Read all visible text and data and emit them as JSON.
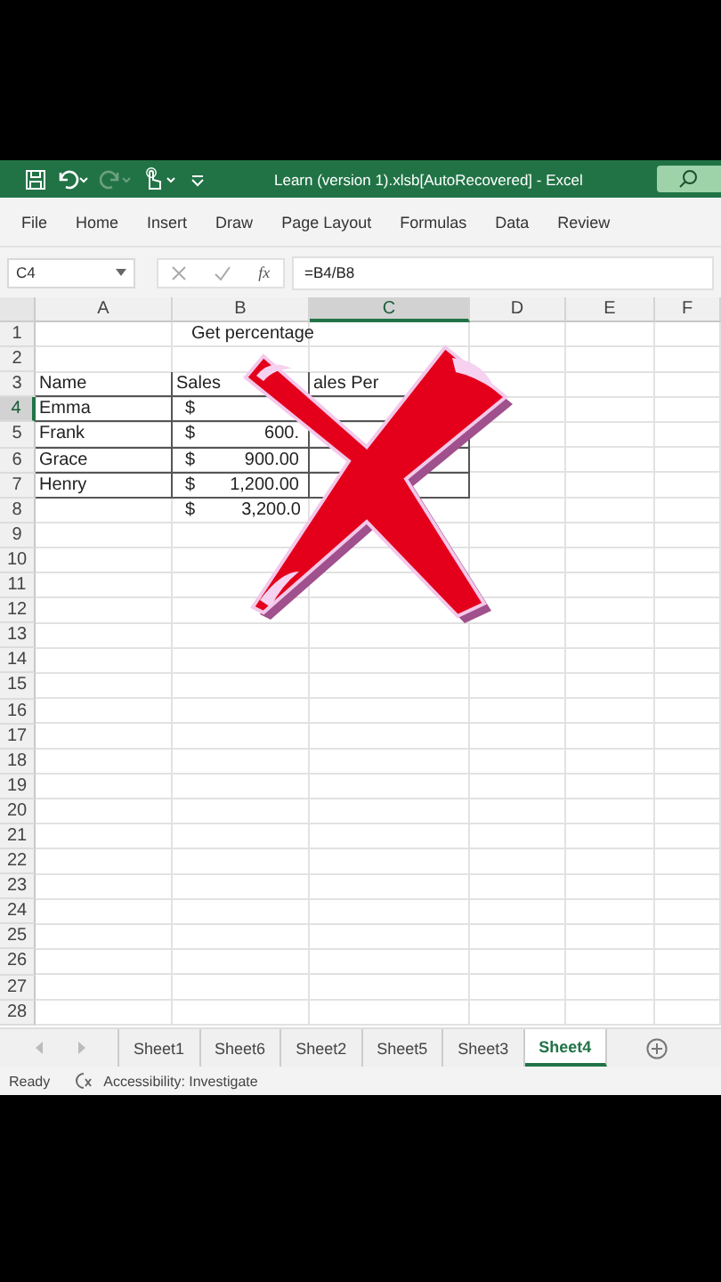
{
  "window": {
    "title": "Learn (version 1).xlsb[AutoRecovered]  -  Excel"
  },
  "quick_access": [
    {
      "kind": "save",
      "disabled": false
    },
    {
      "kind": "undo",
      "disabled": false
    },
    {
      "kind": "redo",
      "disabled": true
    },
    {
      "kind": "touch",
      "disabled": false
    },
    {
      "kind": "customize",
      "disabled": false
    }
  ],
  "ribbon_tabs": [
    "File",
    "Home",
    "Insert",
    "Draw",
    "Page Layout",
    "Formulas",
    "Data",
    "Review"
  ],
  "formula_bar": {
    "name_box": "C4",
    "function_label": "fx",
    "formula": "=B4/B8"
  },
  "columns": [
    {
      "label": "A",
      "selected": false
    },
    {
      "label": "B",
      "selected": false
    },
    {
      "label": "C",
      "selected": true
    },
    {
      "label": "D",
      "selected": false
    },
    {
      "label": "E",
      "selected": false
    },
    {
      "label": "F",
      "selected": false
    }
  ],
  "rows": [
    {
      "header": "1",
      "selected": false,
      "cells": [
        {
          "kind": "title",
          "text": "Get percentage",
          "boxed": false
        }
      ]
    },
    {
      "header": "2",
      "selected": false,
      "cells": []
    },
    {
      "header": "3",
      "selected": false,
      "cells": [
        {
          "kind": "text",
          "text": "Name",
          "boxed": true
        },
        {
          "kind": "text",
          "text": "Sales",
          "boxed": true
        },
        {
          "kind": "text",
          "text": "ales Per",
          "boxed": true
        }
      ]
    },
    {
      "header": "4",
      "selected": true,
      "cells": [
        {
          "kind": "text",
          "text": "Emma",
          "boxed": true
        },
        {
          "kind": "currency",
          "symbol": "$",
          "boxed": true
        },
        {
          "kind": "empty",
          "boxed": true
        }
      ]
    },
    {
      "header": "5",
      "selected": false,
      "cells": [
        {
          "kind": "text",
          "text": "Frank",
          "boxed": true
        },
        {
          "kind": "currency",
          "symbol": "$",
          "value": "600.",
          "boxed": true
        },
        {
          "kind": "empty",
          "boxed": true
        }
      ]
    },
    {
      "header": "6",
      "selected": false,
      "cells": [
        {
          "kind": "text",
          "text": "Grace",
          "boxed": true
        },
        {
          "kind": "currency",
          "symbol": "$",
          "value": "900.00",
          "boxed": true
        },
        {
          "kind": "empty",
          "boxed": true
        }
      ]
    },
    {
      "header": "7",
      "selected": false,
      "cells": [
        {
          "kind": "text",
          "text": "Henry",
          "boxed": true
        },
        {
          "kind": "currency",
          "symbol": "$",
          "value": "1,200.00",
          "boxed": true
        },
        {
          "kind": "empty",
          "boxed": true
        }
      ]
    },
    {
      "header": "8",
      "selected": false,
      "cells": [
        {
          "kind": "empty",
          "boxed": false
        },
        {
          "kind": "currency",
          "symbol": "$",
          "value": "3,200.0",
          "boxed": false
        }
      ]
    },
    {
      "header": "9",
      "selected": false,
      "cells": []
    },
    {
      "header": "10",
      "selected": false,
      "cells": []
    },
    {
      "header": "11",
      "selected": false,
      "cells": []
    },
    {
      "header": "12",
      "selected": false,
      "cells": []
    },
    {
      "header": "13",
      "selected": false,
      "cells": []
    },
    {
      "header": "14",
      "selected": false,
      "cells": []
    },
    {
      "header": "15",
      "selected": false,
      "cells": []
    },
    {
      "header": "16",
      "selected": false,
      "cells": []
    },
    {
      "header": "17",
      "selected": false,
      "cells": []
    },
    {
      "header": "18",
      "selected": false,
      "cells": []
    },
    {
      "header": "19",
      "selected": false,
      "cells": []
    },
    {
      "header": "20",
      "selected": false,
      "cells": []
    },
    {
      "header": "21",
      "selected": false,
      "cells": []
    },
    {
      "header": "22",
      "selected": false,
      "cells": []
    },
    {
      "header": "23",
      "selected": false,
      "cells": []
    },
    {
      "header": "24",
      "selected": false,
      "cells": []
    },
    {
      "header": "25",
      "selected": false,
      "cells": []
    },
    {
      "header": "26",
      "selected": false,
      "cells": []
    },
    {
      "header": "27",
      "selected": false,
      "cells": []
    },
    {
      "header": "28",
      "selected": false,
      "cells": []
    }
  ],
  "sheet_tabs": [
    {
      "label": "Sheet1",
      "selected": false
    },
    {
      "label": "Sheet6",
      "selected": false
    },
    {
      "label": "Sheet2",
      "selected": false
    },
    {
      "label": "Sheet5",
      "selected": false
    },
    {
      "label": "Sheet3",
      "selected": false
    },
    {
      "label": "Sheet4",
      "selected": true
    }
  ],
  "status_bar": {
    "mode": "Ready",
    "accessibility": "Accessibility: Investigate"
  }
}
